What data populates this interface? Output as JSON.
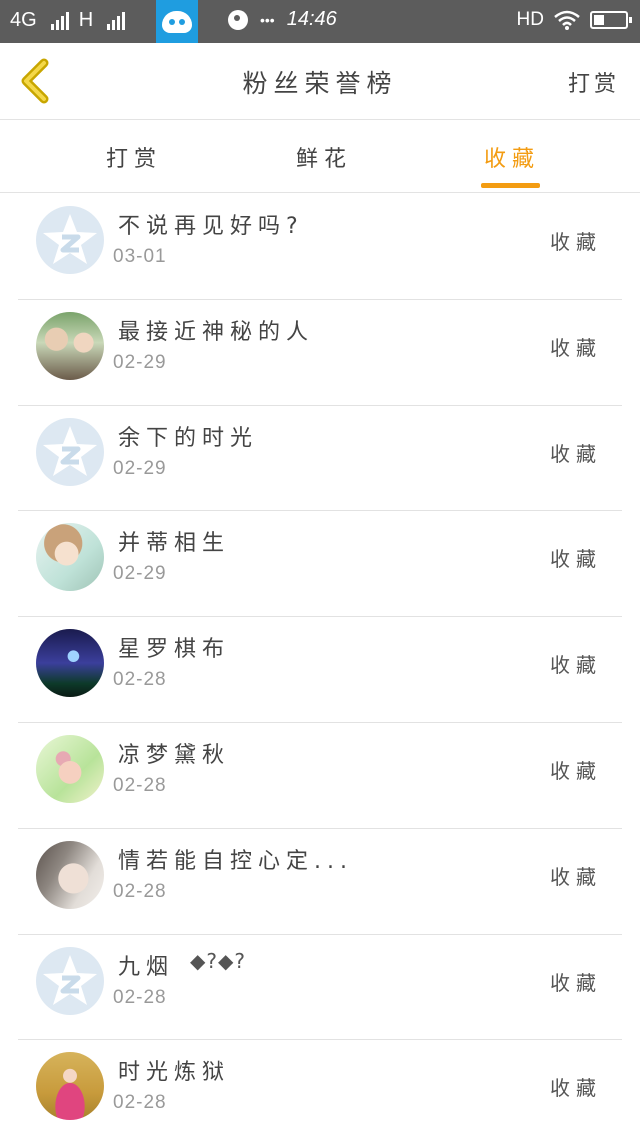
{
  "status_bar": {
    "network": "4G",
    "network2": "H",
    "time": "14:46",
    "dots": "•••",
    "hd": "HD"
  },
  "header": {
    "title": "粉丝荣誉榜",
    "right_action": "打赏"
  },
  "tabs": [
    {
      "label": "打赏",
      "active": false
    },
    {
      "label": "鲜花",
      "active": false
    },
    {
      "label": "收藏",
      "active": true
    }
  ],
  "colors": {
    "accent": "#f39c12",
    "status_bar": "#5c5c5c"
  },
  "fans": [
    {
      "name": "不说再见好吗?",
      "date": "03-01",
      "action": "收藏",
      "avatar": "default-qq-icon"
    },
    {
      "name": "最接近神秘的人",
      "date": "02-29",
      "action": "收藏",
      "avatar": "couple-photo"
    },
    {
      "name": "余下的时光",
      "date": "02-29",
      "action": "收藏",
      "avatar": "default-qq-icon"
    },
    {
      "name": "并蒂相生",
      "date": "02-29",
      "action": "收藏",
      "avatar": "girl-illustration"
    },
    {
      "name": "星罗棋布",
      "date": "02-28",
      "action": "收藏",
      "avatar": "night-scene"
    },
    {
      "name": "凉梦黛秋",
      "date": "02-28",
      "action": "收藏",
      "avatar": "pig-illustration"
    },
    {
      "name": "情若能自控心定...",
      "date": "02-28",
      "action": "收藏",
      "avatar": "woman-portrait"
    },
    {
      "name": "九烟",
      "date": "02-28",
      "action": "收藏",
      "avatar": "default-qq-icon",
      "suffix": "◆?◆?"
    },
    {
      "name": "时光炼狱",
      "date": "02-28",
      "action": "收藏",
      "avatar": "costume-woman"
    }
  ]
}
